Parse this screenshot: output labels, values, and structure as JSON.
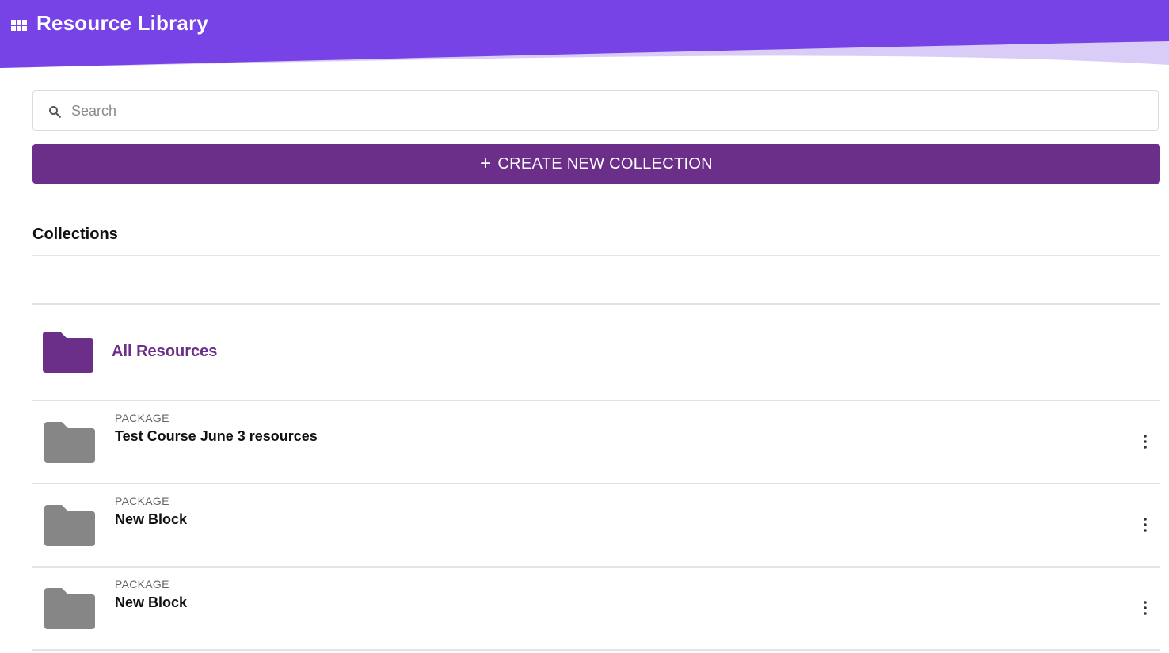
{
  "app": {
    "title": "Resource Library",
    "header_color": "#7743e6",
    "header_accent_color": "#d9ccf7"
  },
  "search": {
    "placeholder": "Search",
    "value": ""
  },
  "create_button": {
    "icon": "plus-icon",
    "label": "CREATE NEW COLLECTION",
    "color": "#6b2e89"
  },
  "collections": {
    "title": "Collections",
    "all_resources": {
      "icon": "folder-icon",
      "label": "All Resources",
      "color": "#6b2e89"
    },
    "packages": [
      {
        "type": "PACKAGE",
        "name": "Test Course June 3 resources",
        "icon": "folder-icon",
        "menu_icon": "more-vert-icon"
      },
      {
        "type": "PACKAGE",
        "name": "New Block",
        "icon": "folder-icon",
        "menu_icon": "more-vert-icon"
      },
      {
        "type": "PACKAGE",
        "name": "New Block",
        "icon": "folder-icon",
        "menu_icon": "more-vert-icon"
      }
    ]
  }
}
